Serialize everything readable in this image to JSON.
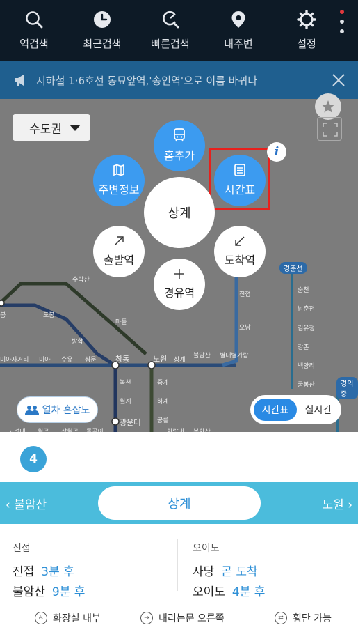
{
  "nav": {
    "items": [
      {
        "label": "역검색",
        "icon": "search-icon"
      },
      {
        "label": "최근검색",
        "icon": "clock-icon"
      },
      {
        "label": "빠른검색",
        "icon": "quick-search-icon"
      },
      {
        "label": "내주변",
        "icon": "location-pin-icon"
      },
      {
        "label": "설정",
        "icon": "gear-icon"
      }
    ],
    "menu_icon": "kebab-menu-icon",
    "notification_dot_color": "#e0393e"
  },
  "notice": {
    "text": "지하철 1·6호선 동묘앞역,'송인역'으로 이름 바뀌나",
    "icon": "megaphone-icon"
  },
  "map": {
    "region_select": "수도권",
    "radial_menu": {
      "center": "상계",
      "add_home": "홈추가",
      "nearby": "주변정보",
      "timetable": "시간표",
      "departure": "출발역",
      "arrival": "도착역",
      "via": "경유역"
    },
    "station_labels": [
      "수락산",
      "도봉",
      "마들",
      "방학",
      "진접",
      "오남",
      "별내별가람",
      "불암산",
      "상계",
      "노원",
      "창동",
      "쌍문",
      "수유",
      "미아",
      "미아사거리",
      "녹천",
      "중계",
      "월계",
      "하계",
      "광운대",
      "공릉",
      "화랑대",
      "봉화산",
      "고려대",
      "월곡",
      "상월곡",
      "돌곶이",
      "순천",
      "남춘천",
      "김유정",
      "강촌",
      "백양리",
      "굴봉산",
      "봉"
    ],
    "line_tags": [
      "경춘선",
      "경의중"
    ],
    "crowd_button": "열차 혼잡도",
    "toggle": {
      "active": "시간표",
      "inactive": "실시간"
    }
  },
  "sheet": {
    "line_number": "4",
    "prev_station": "불암산",
    "current_station": "상계",
    "next_station": "노원",
    "directions": [
      {
        "name": "진접",
        "arrivals": [
          {
            "station": "진접",
            "time": "3분 후"
          },
          {
            "station": "불암산",
            "time": "9분 후"
          }
        ]
      },
      {
        "name": "오이도",
        "arrivals": [
          {
            "station": "사당",
            "time": "곧 도착"
          },
          {
            "station": "오이도",
            "time": "4분 후"
          }
        ]
      }
    ],
    "facilities": [
      {
        "label": "화장실 내부",
        "icon": "restroom-icon"
      },
      {
        "label": "내리는문 오른쪽",
        "icon": "door-right-icon"
      },
      {
        "label": "횡단 가능",
        "icon": "crossing-icon"
      }
    ]
  },
  "colors": {
    "accent": "#3c9bf0",
    "line4": "#3aa3d8",
    "highlight": "#e8201c",
    "nav_bg": "#0d1a26"
  }
}
